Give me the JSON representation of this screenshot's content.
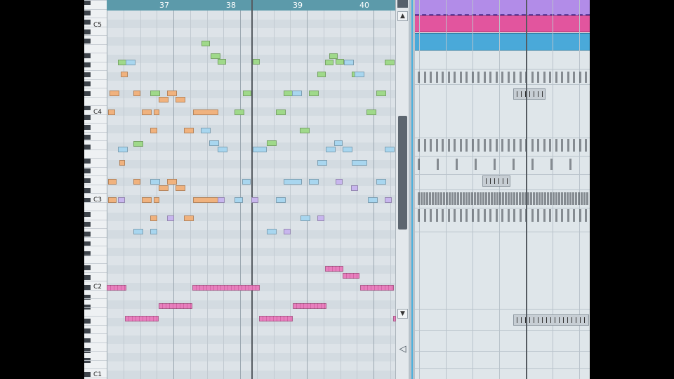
{
  "window": {
    "title": ""
  },
  "ruler": {
    "bars": [
      "37",
      "38",
      "39",
      "40"
    ]
  },
  "keyboard": {
    "labels": [
      "C5",
      "C4",
      "C3",
      "C2",
      "C1"
    ]
  },
  "scrollbar": {
    "up_icon": "▲",
    "down_icon": "▼",
    "zoom_icon": "◁"
  },
  "colors": {
    "green": "#9fd98a",
    "orange": "#f0b27e",
    "blue": "#a8d6ef",
    "purple": "#c8b6ee",
    "pink": "#e77fbd",
    "ruler": "#5c9aaa",
    "track_purple": "#b28ce8",
    "track_magenta": "#e2559e",
    "track_blue": "#4aa9d9",
    "accent": "#4cb0dd"
  },
  "icons": {
    "scroll_up": "arrow-up-icon",
    "scroll_down": "arrow-down-icon",
    "zoom": "zoom-triangle-icon"
  }
}
